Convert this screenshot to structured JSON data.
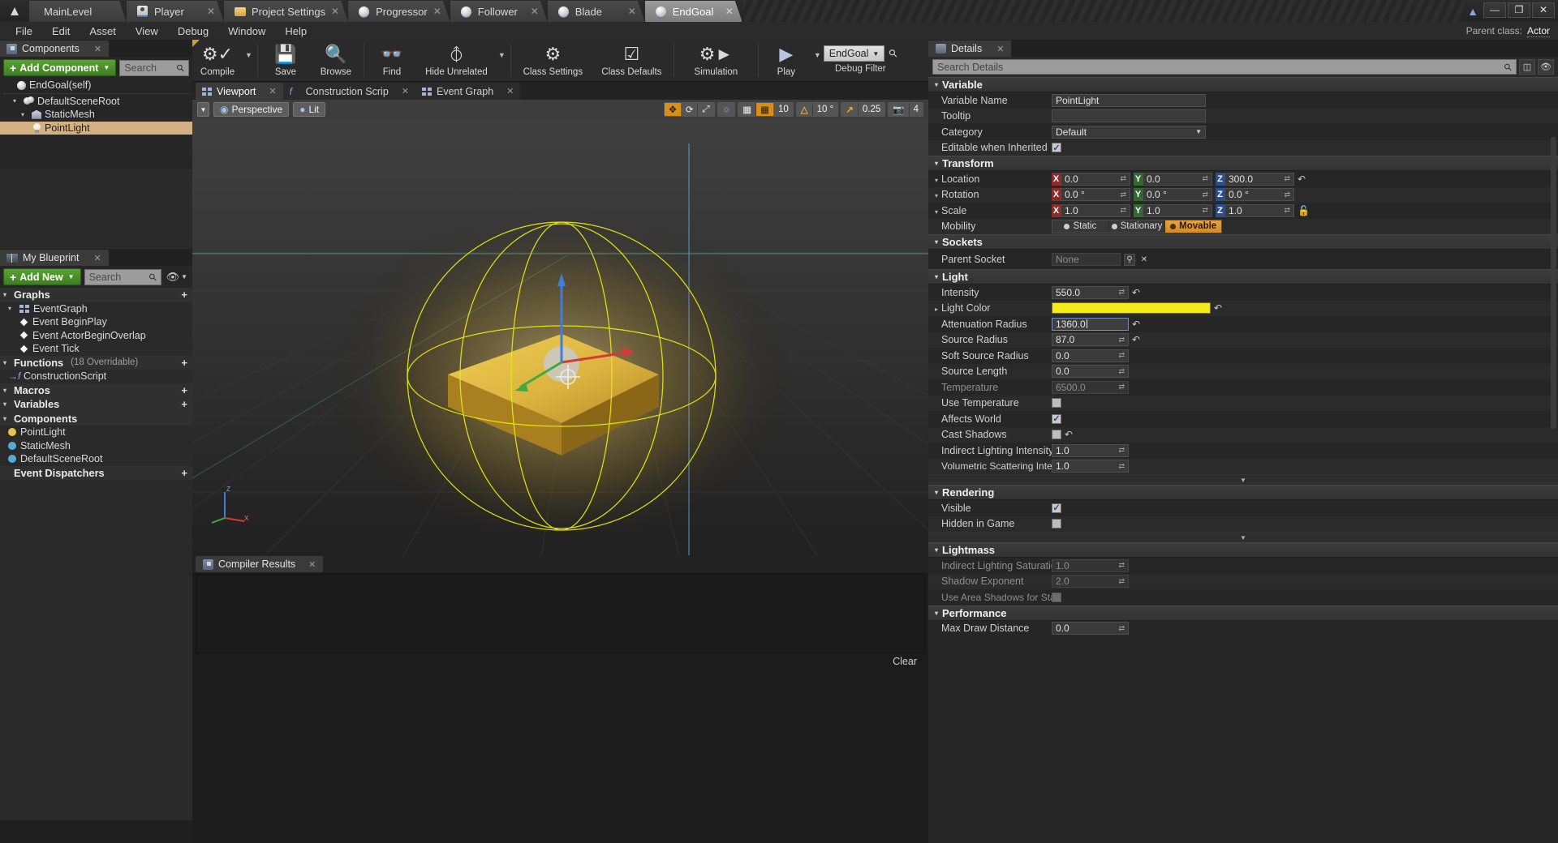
{
  "window": {
    "tabs": [
      {
        "label": "MainLevel",
        "icon": "ue-logo-icon",
        "active": false,
        "closable": false
      },
      {
        "label": "Player",
        "icon": "player-icon",
        "active": false,
        "closable": true
      },
      {
        "label": "Project Settings",
        "icon": "folder-gear-icon",
        "active": false,
        "closable": true
      },
      {
        "label": "Progressor",
        "icon": "blueprint-sphere-icon",
        "active": false,
        "closable": true
      },
      {
        "label": "Follower",
        "icon": "blueprint-sphere-icon",
        "active": false,
        "closable": true
      },
      {
        "label": "Blade",
        "icon": "blueprint-sphere-icon",
        "active": false,
        "closable": true
      },
      {
        "label": "EndGoal",
        "icon": "blueprint-sphere-icon",
        "active": true,
        "closable": true
      }
    ],
    "controls": {
      "minimize": "—",
      "maximize": "❐",
      "close": "✕",
      "help": "graduation-cap-icon"
    }
  },
  "menubar": {
    "items": [
      "File",
      "Edit",
      "Asset",
      "View",
      "Debug",
      "Window",
      "Help"
    ],
    "parent_class_label": "Parent class:",
    "parent_class_value": "Actor"
  },
  "components_panel": {
    "tab_label": "Components",
    "add_button": "Add Component",
    "search_placeholder": "Search",
    "tree": [
      {
        "label": "EndGoal(self)",
        "icon": "blueprint-sphere-icon",
        "depth": 0,
        "selected": false,
        "arrow": ""
      },
      {
        "label": "DefaultSceneRoot",
        "icon": "scene-root-icon",
        "depth": 1,
        "selected": false,
        "arrow": "▾"
      },
      {
        "label": "StaticMesh",
        "icon": "static-mesh-icon",
        "depth": 2,
        "selected": false,
        "arrow": "▾"
      },
      {
        "label": "PointLight",
        "icon": "point-light-icon",
        "depth": 3,
        "selected": true,
        "arrow": ""
      }
    ]
  },
  "my_blueprint_panel": {
    "tab_label": "My Blueprint",
    "add_button": "Add New",
    "search_placeholder": "Search",
    "sections": [
      {
        "title": "Graphs",
        "sub": "",
        "add": "+",
        "rows": [
          {
            "label": "EventGraph",
            "icon": "graph-icon",
            "indent": 1,
            "arrow": "▾"
          },
          {
            "label": "Event BeginPlay",
            "icon": "event-node-icon",
            "indent": 2,
            "arrow": ""
          },
          {
            "label": "Event ActorBeginOverlap",
            "icon": "event-node-icon",
            "indent": 2,
            "arrow": ""
          },
          {
            "label": "Event Tick",
            "icon": "event-node-icon",
            "indent": 2,
            "arrow": ""
          }
        ]
      },
      {
        "title": "Functions",
        "sub": "(18 Overridable)",
        "add": "+",
        "rows": [
          {
            "label": "ConstructionScript",
            "icon": "function-icon",
            "indent": 1,
            "arrow": ""
          }
        ]
      },
      {
        "title": "Macros",
        "sub": "",
        "add": "+",
        "rows": []
      },
      {
        "title": "Variables",
        "sub": "",
        "add": "+",
        "rows": []
      },
      {
        "title": "Components",
        "sub": "",
        "add": "",
        "rows": [
          {
            "label": "PointLight",
            "icon": "point-light-var-icon",
            "indent": 1,
            "arrow": "",
            "color": "#e8c24a"
          },
          {
            "label": "StaticMesh",
            "icon": "static-mesh-var-icon",
            "indent": 1,
            "arrow": "",
            "color": "#5aa7d8"
          },
          {
            "label": "DefaultSceneRoot",
            "icon": "scene-root-var-icon",
            "indent": 1,
            "arrow": "",
            "color": "#5aa7d8"
          }
        ]
      },
      {
        "title": "Event Dispatchers",
        "sub": "",
        "add": "+",
        "rows": []
      }
    ]
  },
  "blueprint_toolbar": {
    "buttons": [
      {
        "label": "Compile",
        "icon": "compile-gears-check-icon",
        "dropdown": true
      },
      {
        "label": "Save",
        "icon": "save-floppy-icon",
        "dropdown": false
      },
      {
        "label": "Browse",
        "icon": "browse-magnifier-icon",
        "dropdown": false
      },
      {
        "label": "Find",
        "icon": "find-binoculars-icon",
        "dropdown": false
      },
      {
        "label": "Hide Unrelated",
        "icon": "hide-unrelated-icon",
        "dropdown": true
      },
      {
        "label": "Class Settings",
        "icon": "class-settings-icon",
        "dropdown": false
      },
      {
        "label": "Class Defaults",
        "icon": "class-defaults-icon",
        "dropdown": false
      },
      {
        "label": "Simulation",
        "icon": "simulation-gear-play-icon",
        "dropdown": false
      },
      {
        "label": "Play",
        "icon": "play-triangle-icon",
        "dropdown": true
      }
    ],
    "debug_filter_value": "EndGoal",
    "debug_filter_label": "Debug Filter",
    "debug_search_icon": "magnifier-icon"
  },
  "graph_tabs": [
    {
      "label": "Viewport",
      "icon": "viewport-grid-icon",
      "active": true
    },
    {
      "label": "Construction Scrip",
      "icon": "function-icon",
      "active": false
    },
    {
      "label": "Event Graph",
      "icon": "graph-icon",
      "active": false
    }
  ],
  "viewport": {
    "view_mode_caret": "▾",
    "perspective_label": "Perspective",
    "perspective_icon": "camera-icon",
    "lit_label": "Lit",
    "lit_icon": "lit-sphere-icon",
    "right_controls": [
      {
        "name": "transform-move-icon",
        "label": "✥",
        "state": "on"
      },
      {
        "name": "transform-rotate-icon",
        "label": "⟳",
        "state": "off"
      },
      {
        "name": "transform-scale-icon",
        "label": "⤢",
        "state": "off"
      },
      {
        "name": "world-coord-icon",
        "label": "🌐",
        "state": "off"
      },
      {
        "name": "surface-snap-icon",
        "label": "▦",
        "state": "off"
      },
      {
        "name": "grid-snap-icon",
        "label": "▦",
        "state": "on"
      },
      {
        "name": "grid-snap-value",
        "label": "10",
        "state": "off"
      },
      {
        "name": "rotation-snap-icon",
        "label": "△",
        "state": "on"
      },
      {
        "name": "rotation-snap-value",
        "label": "10 °",
        "state": "off"
      },
      {
        "name": "scale-snap-icon",
        "label": "↗",
        "state": "on"
      },
      {
        "name": "scale-snap-value",
        "label": "0.25",
        "state": "off"
      },
      {
        "name": "camera-speed-icon",
        "label": "📷",
        "state": "off"
      },
      {
        "name": "camera-speed-value",
        "label": "4",
        "state": "off"
      }
    ],
    "axis_labels": {
      "x": "X",
      "y": "Y",
      "z": "Z"
    }
  },
  "compiler_results": {
    "tab_label": "Compiler Results",
    "icon": "compiler-results-icon",
    "clear_label": "Clear",
    "messages": []
  },
  "details": {
    "tab_label": "Details",
    "icon": "details-icon",
    "search_placeholder": "Search Details",
    "toolbar_icons": [
      "column-layout-icon",
      "eye-icon"
    ],
    "sections": [
      {
        "title": "Variable",
        "rows": [
          {
            "name": "Variable Name",
            "type": "text",
            "value": "PointLight",
            "width": "w190"
          },
          {
            "name": "Tooltip",
            "type": "text",
            "value": "",
            "width": "w190"
          },
          {
            "name": "Category",
            "type": "combo",
            "value": "Default",
            "width": "w190"
          },
          {
            "name": "Editable when Inherited",
            "type": "checkbox",
            "value": true
          }
        ]
      },
      {
        "title": "Transform",
        "rows": [
          {
            "name": "Location",
            "type": "vector",
            "expandable": true,
            "x": "0.0",
            "y": "0.0",
            "z": "300.0",
            "revert": true
          },
          {
            "name": "Rotation",
            "type": "vector",
            "expandable": true,
            "x": "0.0 °",
            "y": "0.0 °",
            "z": "0.0 °"
          },
          {
            "name": "Scale",
            "type": "vector",
            "expandable": true,
            "x": "1.0",
            "y": "1.0",
            "z": "1.0",
            "lock": true
          },
          {
            "name": "Mobility",
            "type": "mobility",
            "options": [
              "Static",
              "Stationary",
              "Movable"
            ],
            "selected": "Movable"
          }
        ]
      },
      {
        "title": "Sockets",
        "rows": [
          {
            "name": "Parent Socket",
            "type": "socket",
            "value": "None"
          }
        ]
      },
      {
        "title": "Light",
        "rows": [
          {
            "name": "Intensity",
            "type": "number",
            "value": "550.0",
            "width": "w95",
            "revert": true
          },
          {
            "name": "Light Color",
            "type": "color",
            "expandable": true,
            "value": "#f5eb16",
            "revert": true
          },
          {
            "name": "Attenuation Radius",
            "type": "number",
            "value": "1360.0",
            "width": "w95",
            "revert": true,
            "focused": true
          },
          {
            "name": "Source Radius",
            "type": "number",
            "value": "87.0",
            "width": "w95",
            "revert": true
          },
          {
            "name": "Soft Source Radius",
            "type": "number",
            "value": "0.0",
            "width": "w95"
          },
          {
            "name": "Source Length",
            "type": "number",
            "value": "0.0",
            "width": "w95"
          },
          {
            "name": "Temperature",
            "type": "number",
            "value": "6500.0",
            "width": "w95",
            "disabled": true
          },
          {
            "name": "Use Temperature",
            "type": "checkbox",
            "value": false
          },
          {
            "name": "Affects World",
            "type": "checkbox",
            "value": true
          },
          {
            "name": "Cast Shadows",
            "type": "checkbox",
            "value": false,
            "revert": true
          },
          {
            "name": "Indirect Lighting Intensity",
            "type": "number",
            "value": "1.0",
            "width": "w95"
          },
          {
            "name": "Volumetric Scattering Intensity",
            "type": "number",
            "value": "1.0",
            "width": "w95"
          }
        ]
      },
      {
        "title": "Rendering",
        "rows": [
          {
            "name": "Visible",
            "type": "checkbox",
            "value": true
          },
          {
            "name": "Hidden in Game",
            "type": "checkbox",
            "value": false
          }
        ]
      },
      {
        "title": "Lightmass",
        "rows": [
          {
            "name": "Indirect Lighting Saturation",
            "type": "number",
            "value": "1.0",
            "width": "w95",
            "disabled": true
          },
          {
            "name": "Shadow Exponent",
            "type": "number",
            "value": "2.0",
            "width": "w95",
            "disabled": true
          },
          {
            "name": "Use Area Shadows for Stationa",
            "type": "checkbox",
            "value": false,
            "disabled": true
          }
        ]
      },
      {
        "title": "Performance",
        "rows": [
          {
            "name": "Max Draw Distance",
            "type": "number",
            "value": "0.0",
            "width": "w95"
          }
        ]
      }
    ]
  }
}
